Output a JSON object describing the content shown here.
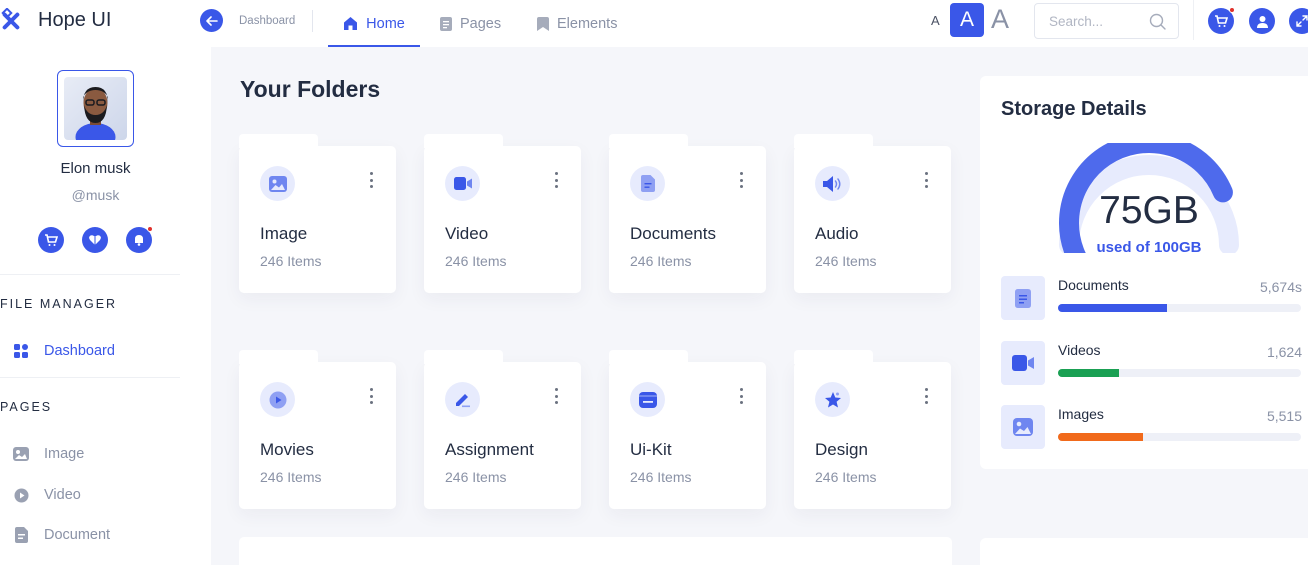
{
  "brand": {
    "name": "Hope UI"
  },
  "user": {
    "name": "Elon musk",
    "handle": "@musk"
  },
  "sidebar": {
    "sections": [
      {
        "title": "FILE MANAGER",
        "items": [
          {
            "label": "Dashboard",
            "icon": "grid-icon",
            "active": true
          }
        ]
      },
      {
        "title": "PAGES",
        "items": [
          {
            "label": "Image",
            "icon": "image-icon"
          },
          {
            "label": "Video",
            "icon": "play-icon"
          },
          {
            "label": "Document",
            "icon": "document-icon"
          }
        ]
      }
    ]
  },
  "topbar": {
    "breadcrumb": "Dashboard",
    "tabs": [
      {
        "label": "Home",
        "icon": "home-icon",
        "active": true
      },
      {
        "label": "Pages",
        "icon": "page-icon"
      },
      {
        "label": "Elements",
        "icon": "bookmark-icon"
      }
    ],
    "font_sizes": [
      "A",
      "A",
      "A"
    ],
    "search_placeholder": "Search..."
  },
  "main": {
    "heading": "Your Folders",
    "folders": [
      {
        "name": "Image",
        "count": "246 Items",
        "icon": "image-icon"
      },
      {
        "name": "Video",
        "count": "246 Items",
        "icon": "video-camera-icon"
      },
      {
        "name": "Documents",
        "count": "246 Items",
        "icon": "document-icon"
      },
      {
        "name": "Audio",
        "count": "246 Items",
        "icon": "speaker-icon"
      },
      {
        "name": "Movies",
        "count": "246 Items",
        "icon": "play-icon"
      },
      {
        "name": "Assignment",
        "count": "246 Items",
        "icon": "pencil-icon"
      },
      {
        "name": "Ui-Kit",
        "count": "246 Items",
        "icon": "wallet-icon"
      },
      {
        "name": "Design",
        "count": "246 Items",
        "icon": "star-icon"
      }
    ]
  },
  "storage": {
    "title": "Storage Details",
    "used": "75GB",
    "caption": "used of 100GB",
    "used_fraction": 0.75,
    "items": [
      {
        "label": "Documents",
        "count": "5,674s",
        "fill": 0.45,
        "color": "#3a57e8",
        "icon": "document-icon"
      },
      {
        "label": "Videos",
        "count": "1,624",
        "fill": 0.25,
        "color": "#1aa053",
        "icon": "video-camera-icon"
      },
      {
        "label": "Images",
        "count": "5,515",
        "fill": 0.35,
        "color": "#f16a1b",
        "icon": "image-icon"
      }
    ]
  },
  "colors": {
    "accent": "#3a57e8",
    "muted": "#8a92a6",
    "background": "#f5f6fa"
  }
}
